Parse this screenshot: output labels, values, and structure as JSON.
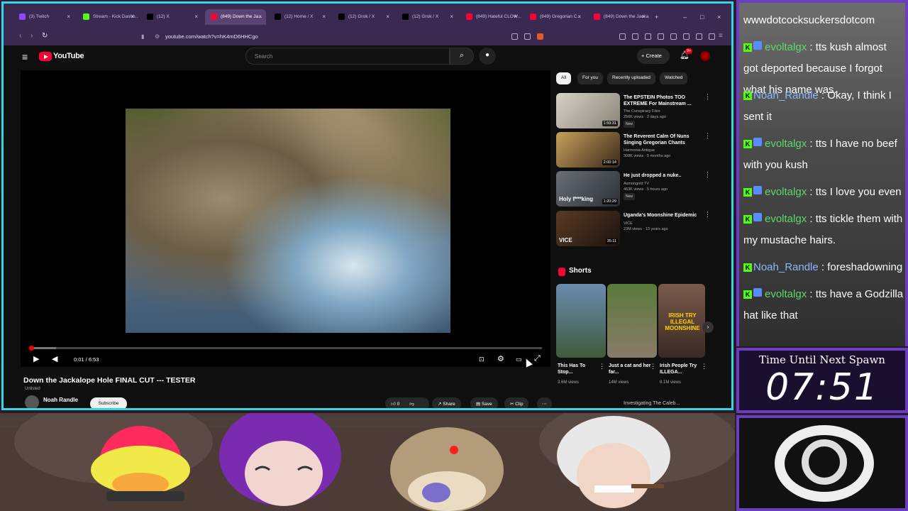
{
  "browser": {
    "tabs": [
      {
        "label": "(3) Twitch",
        "color": "#9146ff"
      },
      {
        "label": "Stream - Kick Dashb...",
        "color": "#53fc18"
      },
      {
        "label": "(12) X",
        "color": "#000000"
      },
      {
        "label": "(849) Down the Ja...",
        "color": "#ff0033",
        "active": true
      },
      {
        "label": "(12) Home / X",
        "color": "#000000"
      },
      {
        "label": "(12) Grok / X",
        "color": "#000000"
      },
      {
        "label": "(12) Grok / X",
        "color": "#000000"
      },
      {
        "label": "(849) Hateful CLOW...",
        "color": "#ff0033"
      },
      {
        "label": "(849) Gregorian C...",
        "color": "#ff0033"
      },
      {
        "label": "(849) Down the Jacka...",
        "color": "#ff0033"
      }
    ],
    "url": "youtube.com/watch?v=hK4mD6HHCgo",
    "close_glyph": "×",
    "new_tab": "+",
    "win_min": "–",
    "win_max": "□",
    "win_close": "×"
  },
  "youtube": {
    "logo_text": "YouTube",
    "search_placeholder": "Search",
    "create_label": "Create",
    "notif_count": "9+",
    "player": {
      "time": "0:01 / 6:53",
      "progress_fraction": 0.004
    },
    "video_title": "Down the Jackalope Hole FINAL CUT --- TESTER",
    "visibility": "Unlisted",
    "channel_name": "Noah Randle",
    "subscribe_label": "Subscribe",
    "actions": {
      "like_count": "0",
      "share_label": "Share",
      "save_label": "Save",
      "clip_label": "Clip"
    },
    "chips": [
      "All",
      "For you",
      "Recently uploaded",
      "Watched"
    ],
    "recommendations": [
      {
        "title": "The EPSTEIN Photos TOO EXTREME For Mainstream ...",
        "channel": "The Conspiracy Files",
        "meta": "256K views · 2 days ago",
        "duration": "1:59:31",
        "new": "New"
      },
      {
        "title": "The Reverent Calm Of Nuns Singing Gregorian Chants",
        "channel": "Harmonia Antiqua",
        "meta": "308K views · 5 months ago",
        "duration": "2:00:14",
        "new": ""
      },
      {
        "title": "He just dropped a nuke..",
        "channel": "Asmongold TV",
        "meta": "463K views · 5 hours ago",
        "duration": "1:20:29",
        "new": "New"
      },
      {
        "title": "Uganda's Moonshine Epidemic",
        "channel": "VICE",
        "meta": "23M views · 13 years ago",
        "duration": "35:11",
        "new": ""
      }
    ],
    "shorts_label": "Shorts",
    "shorts": [
      {
        "title": "This Has To Stop...",
        "views": "3.6M views"
      },
      {
        "title": "Just a cat and her far...",
        "views": "14M views"
      },
      {
        "title": "Irish People Try ILLEGA...",
        "views": "8.1M views"
      }
    ],
    "thumb_overlays": {
      "holy": "Holy f***king",
      "vice": "VICE",
      "irish": "IRISH TRY ILLEGAL MOONSHINE"
    },
    "next_rec_peek": "Investigating The Caleb..."
  },
  "chat": {
    "messages": [
      {
        "user": "",
        "text": "wwwdotcocksuckersdotcom",
        "badges": false,
        "ucolor": "g"
      },
      {
        "user": "evoltalgx",
        "text": " : tts kush almost got deported because I forgot what his name was.",
        "badges": true,
        "ucolor": "g"
      },
      {
        "user": "Noah_Randle",
        "text": " : Okay, I think I sent it",
        "badges": false,
        "ucolor": "b"
      },
      {
        "user": "evoltalgx",
        "text": " : tts I have no beef with you kush",
        "badges": true,
        "ucolor": "g"
      },
      {
        "user": "evoltalgx",
        "text": " : tts I love you even",
        "badges": true,
        "ucolor": "g"
      },
      {
        "user": "evoltalgx",
        "text": " : tts tickle them with my mustache hairs.",
        "badges": true,
        "ucolor": "g"
      },
      {
        "user": "Noah_Randle",
        "text": " : foreshadowning",
        "badges": false,
        "ucolor": "b"
      },
      {
        "user": "evoltalgx",
        "text": " : tts have a Godzilla hat like that",
        "badges": true,
        "ucolor": "g"
      }
    ]
  },
  "timer": {
    "label": "Time Until Next Spawn",
    "value": "07:51"
  },
  "colors": {
    "frame_cyan": "#36d6e0",
    "panel_purple": "#6c3dbe",
    "yt_red": "#ff0033",
    "kick_green": "#53fc18"
  }
}
